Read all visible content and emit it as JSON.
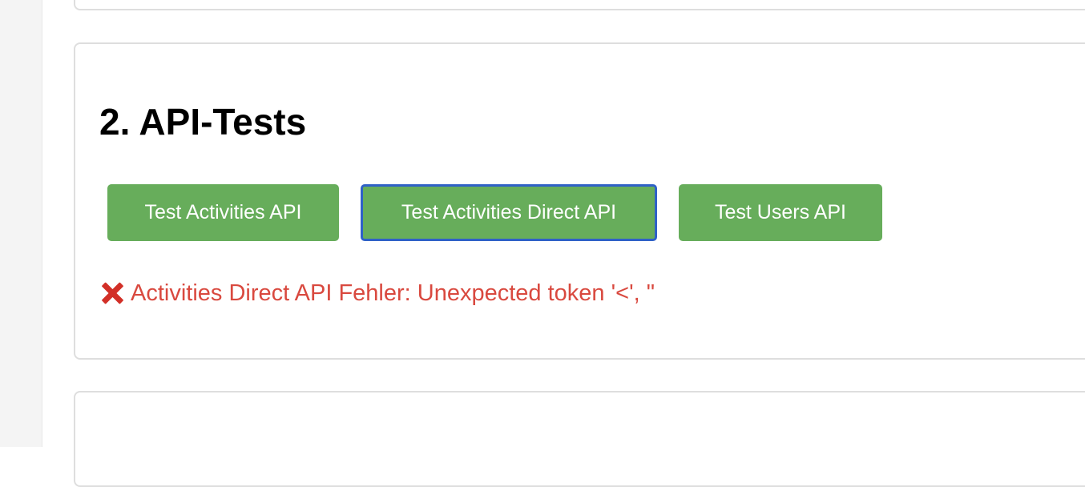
{
  "section": {
    "title": "2. API-Tests"
  },
  "buttons": {
    "activities_label": "Test Activities API",
    "activities_direct_label": "Test Activities Direct API",
    "users_label": "Test Users API"
  },
  "status": {
    "icon": "error-x-icon",
    "message": "Activities Direct API Fehler: Unexpected token '<', \"",
    "color": "#d9493f"
  },
  "colors": {
    "button_green": "#67ad5b",
    "focus_ring": "#2f61c7",
    "error_icon": "#d22f27"
  }
}
